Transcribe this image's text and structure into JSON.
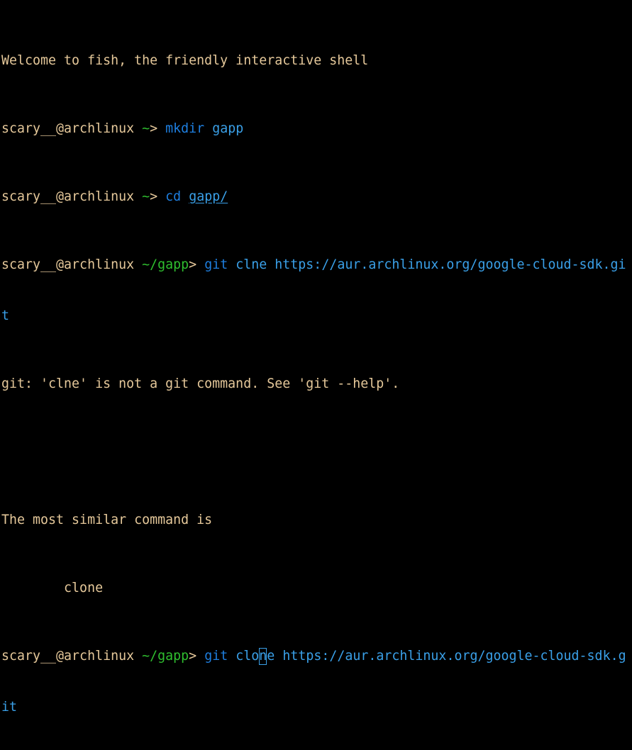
{
  "colors": {
    "background": "#000000",
    "text": "#e5c89a",
    "prompt_path": "#2fbf2f",
    "command": "#1e7fe0",
    "argument": "#3aa0e8"
  },
  "terminal": {
    "welcome": "Welcome to fish, the friendly interactive shell",
    "prompt_user": "scary__@archlinux",
    "cwd_home": "~",
    "cwd_gapp": "~/gapp",
    "prompt_symbol": "> ",
    "line1": {
      "command": "mkdir",
      "argument": "gapp"
    },
    "line2": {
      "command": "cd",
      "argument": "gapp/"
    },
    "line3": {
      "command": "git",
      "argument": "clne",
      "url_part1": "https://aur.archlinux.org/google-cloud-sdk.gi",
      "url_part2": "t"
    },
    "error": "git: 'clne' is not a git command. See 'git --help'.",
    "suggestion_heading": "The most similar command is",
    "suggestion": "        clone",
    "line4": {
      "command": "git",
      "arg_before_cursor": "clo",
      "arg_cursor_char": "n",
      "arg_after_cursor": "e",
      "url_part1": "https://aur.archlinux.org/google-cloud-sdk.g",
      "url_part2": "it"
    }
  }
}
